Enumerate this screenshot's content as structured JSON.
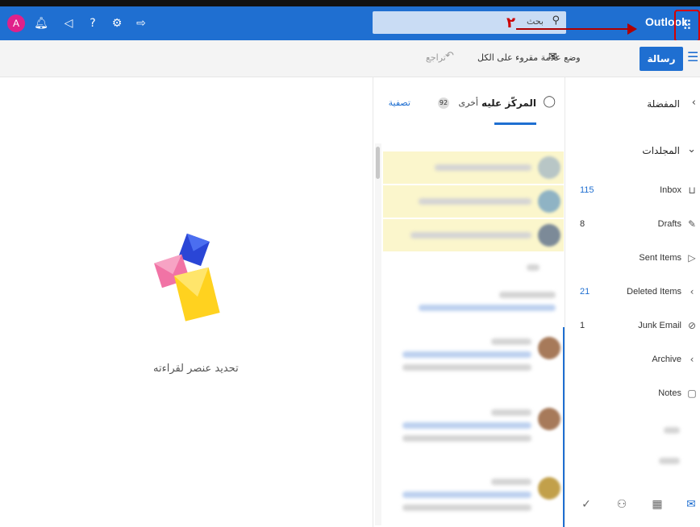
{
  "topbar": {
    "app_name": "Outlook",
    "avatar_letter": "A",
    "search_placeholder": "بحث",
    "step_number": "٢",
    "icons": [
      "bell-icon",
      "megaphone-icon",
      "help-icon",
      "settings-icon",
      "send-feedback-icon",
      "app-launcher-icon"
    ]
  },
  "commands": {
    "new_message": "رسالة جديدة",
    "mark_all_read": "وضع علامة مقروء على الكل",
    "undo": "تراجع"
  },
  "message_list": {
    "tab_focused": "المركّز عليه",
    "tab_other": "أخرى",
    "other_badge": "92",
    "filter": "تصفية"
  },
  "reading_pane": {
    "hint": "تحديد عنصر لقراءته"
  },
  "folders": {
    "favorites": "المفضلة",
    "folders_header": "المجلدات",
    "items": [
      {
        "label": "Inbox",
        "count": "115",
        "icon": "inbox-icon",
        "highlight": true
      },
      {
        "label": "Drafts",
        "count": "8",
        "icon": "pencil-icon",
        "highlight": false
      },
      {
        "label": "Sent Items",
        "count": "",
        "icon": "send-icon",
        "highlight": false
      },
      {
        "label": "Deleted Items",
        "count": "21",
        "icon": "chevron-icon",
        "highlight": true
      },
      {
        "label": "Junk Email",
        "count": "1",
        "icon": "block-icon",
        "highlight": false
      },
      {
        "label": "Archive",
        "count": "",
        "icon": "chevron-icon",
        "highlight": false
      },
      {
        "label": "Notes",
        "count": "",
        "icon": "note-icon",
        "highlight": false
      }
    ]
  },
  "colors": {
    "brand": "#1f6fd1",
    "avatar": "#e0218a",
    "annotation": "#d60000",
    "highlight_row": "#fbf6cc"
  }
}
